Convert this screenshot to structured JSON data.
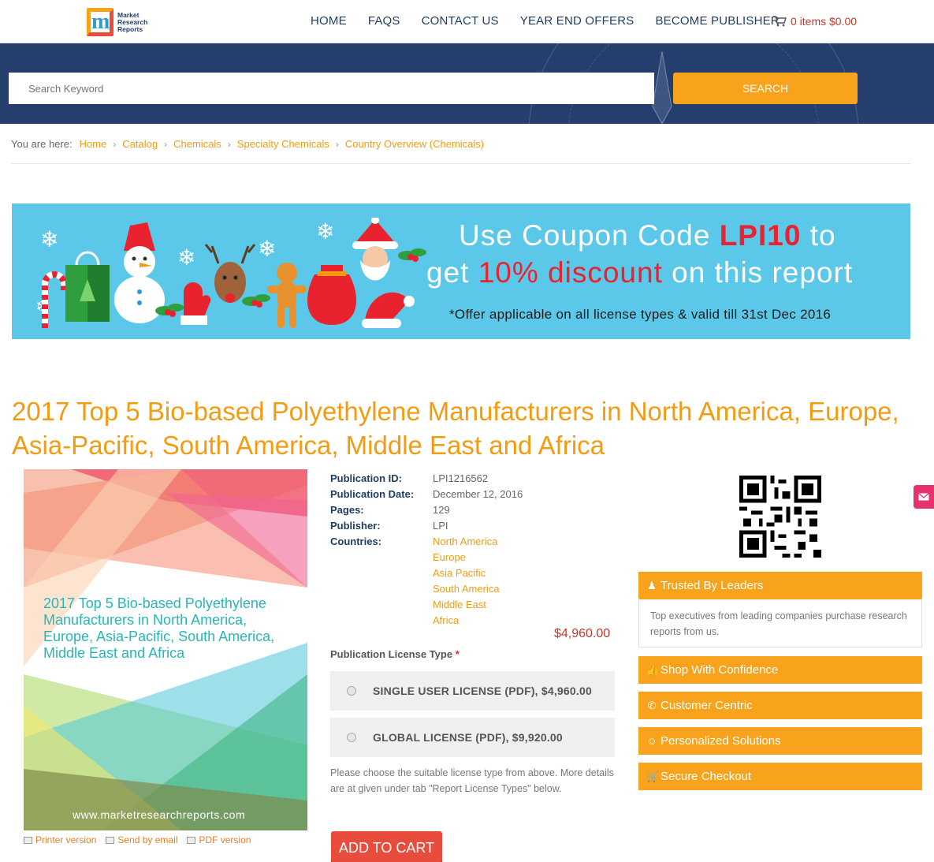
{
  "brand": {
    "logo_letter": "m",
    "logo_text": "Market Research Reports"
  },
  "nav": {
    "items": [
      "HOME",
      "FAQS",
      "CONTACT US",
      "YEAR END OFFERS",
      "BECOME PUBLISHER"
    ],
    "cart_label": "0 items $0.00"
  },
  "search": {
    "placeholder": "Search Keyword",
    "button_label": "SEARCH"
  },
  "breadcrumb": {
    "label": "You are here:",
    "items": [
      "Home",
      "Catalog",
      "Chemicals",
      "Specialty Chemicals",
      "Country Overview (Chemicals)"
    ]
  },
  "banner": {
    "line1_pre": "Use Coupon Code ",
    "line1_code": "LPI10",
    "line1_post": " to",
    "line2_pre": "get ",
    "line2_discount": "10% discount",
    "line2_post": " on this report",
    "note": "*Offer applicable on all license types & valid till 31st Dec 2016"
  },
  "report": {
    "title": "2017 Top 5 Bio-based Polyethylene Manufacturers in North America, Europe, Asia-Pacific, South America, Middle East and Africa",
    "cover_title": "2017 Top 5 Bio-based Polyethylene Manufacturers in North America, Europe, Asia-Pacific, South America, Middle East and Africa",
    "cover_url": "www.marketresearchreports.com",
    "links": [
      "Printer version",
      "Send by email",
      "PDF version"
    ],
    "details": {
      "id_label": "Publication ID:",
      "id": "LPI1216562",
      "date_label": "Publication Date:",
      "date": "December 12, 2016",
      "pages_label": "Pages:",
      "pages": "129",
      "publisher_label": "Publisher:",
      "publisher": "LPI",
      "countries_label": "Countries:",
      "countries": [
        "North America",
        "Europe",
        "Asia Pacific",
        "South America",
        "Middle East",
        "Africa"
      ]
    },
    "price": "$4,960.00",
    "license_label": "Publication License Type",
    "license_required": "*",
    "licenses": [
      "SINGLE USER LICENSE (PDF), $4,960.00",
      "GLOBAL LICENSE (PDF), $9,920.00"
    ],
    "license_help": "Please choose the suitable license type from above. More details are at given under tab \"Report License Types\" below.",
    "add_to_cart": "ADD TO CART"
  },
  "sidebar": {
    "trusted_title": "Trusted By Leaders",
    "trusted_body": "Top executives from leading companies purchase research reports from us.",
    "items": [
      "Shop With Confidence",
      "Customer Centric",
      "Personalized Solutions",
      "Secure Checkout"
    ]
  },
  "colors": {
    "accent": "#f39c12",
    "navy": "#243f6e",
    "banner": "#5bc8ea",
    "red": "#e84c3d"
  }
}
